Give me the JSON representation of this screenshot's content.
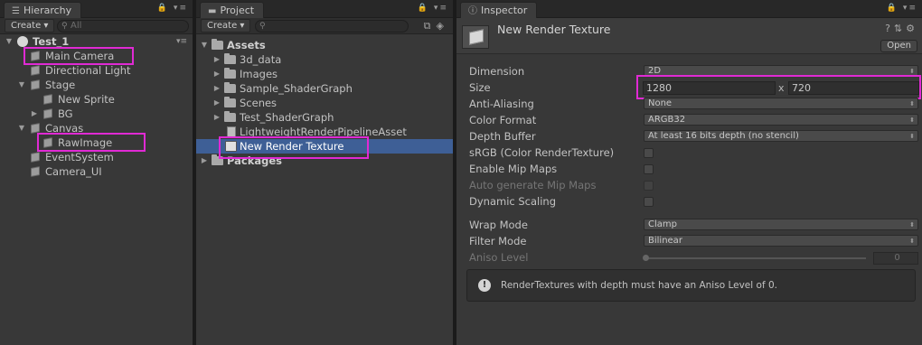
{
  "hierarchy": {
    "tab_label": "Hierarchy",
    "tab_icon": "list-icon",
    "create_label": "Create",
    "search_placeholder": "All",
    "scene_name": "Test_1",
    "items": [
      {
        "label": "Main Camera",
        "depth": 1,
        "expandable": false
      },
      {
        "label": "Directional Light",
        "depth": 1,
        "expandable": false
      },
      {
        "label": "Stage",
        "depth": 1,
        "expandable": true,
        "expanded": true
      },
      {
        "label": "New Sprite",
        "depth": 2,
        "expandable": false
      },
      {
        "label": "BG",
        "depth": 2,
        "expandable": true,
        "expanded": false
      },
      {
        "label": "Canvas",
        "depth": 1,
        "expandable": true,
        "expanded": true
      },
      {
        "label": "RawImage",
        "depth": 2,
        "expandable": false
      },
      {
        "label": "EventSystem",
        "depth": 1,
        "expandable": false
      },
      {
        "label": "Camera_UI",
        "depth": 1,
        "expandable": false
      }
    ]
  },
  "project": {
    "tab_label": "Project",
    "tab_icon": "folder-icon",
    "create_label": "Create",
    "assets_label": "Assets",
    "packages_label": "Packages",
    "items": [
      {
        "label": "3d_data",
        "type": "folder"
      },
      {
        "label": "Images",
        "type": "folder"
      },
      {
        "label": "Sample_ShaderGraph",
        "type": "folder"
      },
      {
        "label": "Scenes",
        "type": "folder"
      },
      {
        "label": "Test_ShaderGraph",
        "type": "folder"
      },
      {
        "label": "LightweightRenderPipelineAsset",
        "type": "asset"
      },
      {
        "label": "New Render Texture",
        "type": "render-texture",
        "selected": true
      }
    ]
  },
  "inspector": {
    "tab_label": "Inspector",
    "tab_icon": "info-icon",
    "title": "New Render Texture",
    "open_label": "Open",
    "props": {
      "dimension": {
        "label": "Dimension",
        "value": "2D"
      },
      "size": {
        "label": "Size",
        "width": "1280",
        "x": "x",
        "height": "720"
      },
      "anti_aliasing": {
        "label": "Anti-Aliasing",
        "value": "None"
      },
      "color_format": {
        "label": "Color Format",
        "value": "ARGB32"
      },
      "depth_buffer": {
        "label": "Depth Buffer",
        "value": "At least 16 bits depth (no stencil)"
      },
      "srgb": {
        "label": "sRGB (Color RenderTexture)",
        "checked": false
      },
      "mip_maps": {
        "label": "Enable Mip Maps",
        "checked": false
      },
      "auto_mip": {
        "label": "Auto generate Mip Maps",
        "checked": false,
        "disabled": true
      },
      "dynamic_scaling": {
        "label": "Dynamic Scaling",
        "checked": false
      },
      "wrap_mode": {
        "label": "Wrap Mode",
        "value": "Clamp"
      },
      "filter_mode": {
        "label": "Filter Mode",
        "value": "Bilinear"
      },
      "aniso_level": {
        "label": "Aniso Level",
        "value": "0",
        "level": 0
      }
    },
    "help_text": "RenderTextures with depth must have an Aniso Level of 0."
  },
  "colors": {
    "highlight": "#e02ad4",
    "selection": "#3e5f96",
    "panel_bg": "#383838"
  }
}
